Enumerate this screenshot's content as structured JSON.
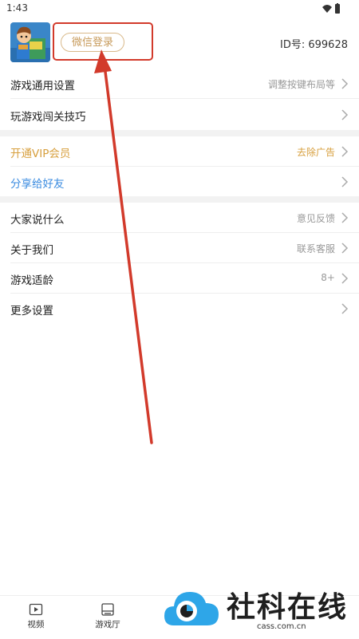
{
  "status_bar": {
    "time": "1:43"
  },
  "header": {
    "login_label": "微信登录",
    "id_text": "ID号: 699628"
  },
  "menu_group1": [
    {
      "label": "游戏通用设置",
      "value": "调整按键布局等"
    },
    {
      "label": "玩游戏闯关技巧",
      "value": ""
    }
  ],
  "menu_group2": [
    {
      "label": "开通VIP会员",
      "value": "去除广告"
    },
    {
      "label": "分享给好友",
      "value": ""
    }
  ],
  "menu_group3": [
    {
      "label": "大家说什么",
      "value": "意见反馈"
    },
    {
      "label": "关于我们",
      "value": "联系客服"
    },
    {
      "label": "游戏适龄",
      "value": "8+"
    },
    {
      "label": "更多设置",
      "value": ""
    }
  ],
  "bottom_nav": [
    {
      "label": "视频",
      "icon": "video-icon"
    },
    {
      "label": "游戏厅",
      "icon": "arcade-icon"
    }
  ],
  "watermark": {
    "brand": "社科在线",
    "url": "cass.com.cn"
  },
  "colors": {
    "vip": "#d79f3d",
    "share": "#3a8be0",
    "annotation": "#d23a2b",
    "login_border": "#d9b98a"
  }
}
